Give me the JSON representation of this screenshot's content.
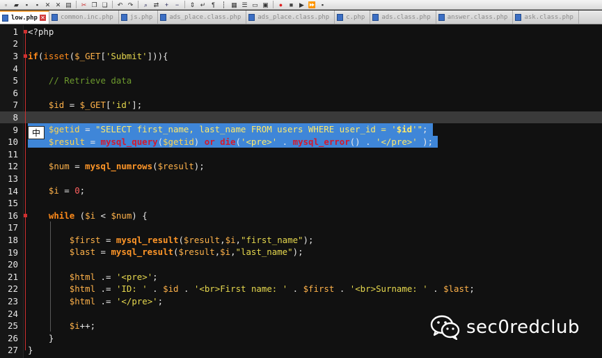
{
  "toolbar": {
    "icons": [
      "new-file-icon",
      "open-folder-icon",
      "save-icon",
      "save-all-icon",
      "close-icon",
      "close-all-icon",
      "print-icon",
      "cut-icon",
      "copy-icon",
      "paste-icon",
      "undo-icon",
      "redo-icon",
      "find-icon",
      "replace-icon",
      "zoom-in-icon",
      "zoom-out-icon",
      "sync-scroll-icon",
      "wrap-icon",
      "show-all-chars-icon",
      "indent-guide-icon",
      "doc-map-icon",
      "function-list-icon",
      "folder-workspace-icon",
      "monitor-icon",
      "record-macro-icon",
      "stop-macro-icon",
      "playback-macro-icon",
      "run-macro-icon",
      "save-macro-icon"
    ]
  },
  "tabs": [
    {
      "label": "low.php",
      "active": true
    },
    {
      "label": "common.inc.php",
      "active": false
    },
    {
      "label": "js.php",
      "active": false
    },
    {
      "label": "ads_place.class.php",
      "active": false
    },
    {
      "label": "ads_place.class.php",
      "active": false
    },
    {
      "label": "c.php",
      "active": false
    },
    {
      "label": "ads.class.php",
      "active": false
    },
    {
      "label": "answer.class.php",
      "active": false
    },
    {
      "label": "ask.class.php",
      "active": false
    }
  ],
  "editor": {
    "current_line": 8,
    "selected_lines": [
      9,
      10
    ],
    "lines": [
      {
        "n": "1",
        "text": "<?php"
      },
      {
        "n": "2",
        "text": ""
      },
      {
        "n": "3",
        "text": "if(isset($_GET['Submit'])){"
      },
      {
        "n": "4",
        "text": ""
      },
      {
        "n": "5",
        "text": "    // Retrieve data"
      },
      {
        "n": "6",
        "text": ""
      },
      {
        "n": "7",
        "text": "    $id = $_GET['id'];"
      },
      {
        "n": "8",
        "text": ""
      },
      {
        "n": "9",
        "text": "    $getid = \"SELECT first_name, last_name FROM users WHERE user_id = '$id'\";"
      },
      {
        "n": "10",
        "text": "    $result = mysql_query($getid) or die('<pre>' . mysql_error() . '</pre>' );"
      },
      {
        "n": "11",
        "text": ""
      },
      {
        "n": "12",
        "text": "    $num = mysql_numrows($result);"
      },
      {
        "n": "13",
        "text": ""
      },
      {
        "n": "14",
        "text": "    $i = 0;"
      },
      {
        "n": "15",
        "text": ""
      },
      {
        "n": "16",
        "text": "    while ($i < $num) {"
      },
      {
        "n": "17",
        "text": ""
      },
      {
        "n": "18",
        "text": "        $first = mysql_result($result,$i,\"first_name\");"
      },
      {
        "n": "19",
        "text": "        $last = mysql_result($result,$i,\"last_name\");"
      },
      {
        "n": "20",
        "text": ""
      },
      {
        "n": "21",
        "text": "        $html .= '<pre>';"
      },
      {
        "n": "22",
        "text": "        $html .= 'ID: ' . $id . '<br>First name: ' . $first . '<br>Surname: ' . $last;"
      },
      {
        "n": "23",
        "text": "        $html .= '</pre>';"
      },
      {
        "n": "24",
        "text": ""
      },
      {
        "n": "25",
        "text": "        $i++;"
      },
      {
        "n": "26",
        "text": "    }"
      },
      {
        "n": "27",
        "text": "}"
      }
    ]
  },
  "ime": {
    "label": "中"
  },
  "watermark": {
    "text": "sec0redclub"
  },
  "colors": {
    "background": "#111111",
    "current_line": "#3a3a3a",
    "selection": "#3f86d8",
    "keyword": "#ff8a1a",
    "string": "#e6d84e",
    "comment": "#6d9a2e",
    "fold_marker": "#d03030"
  }
}
